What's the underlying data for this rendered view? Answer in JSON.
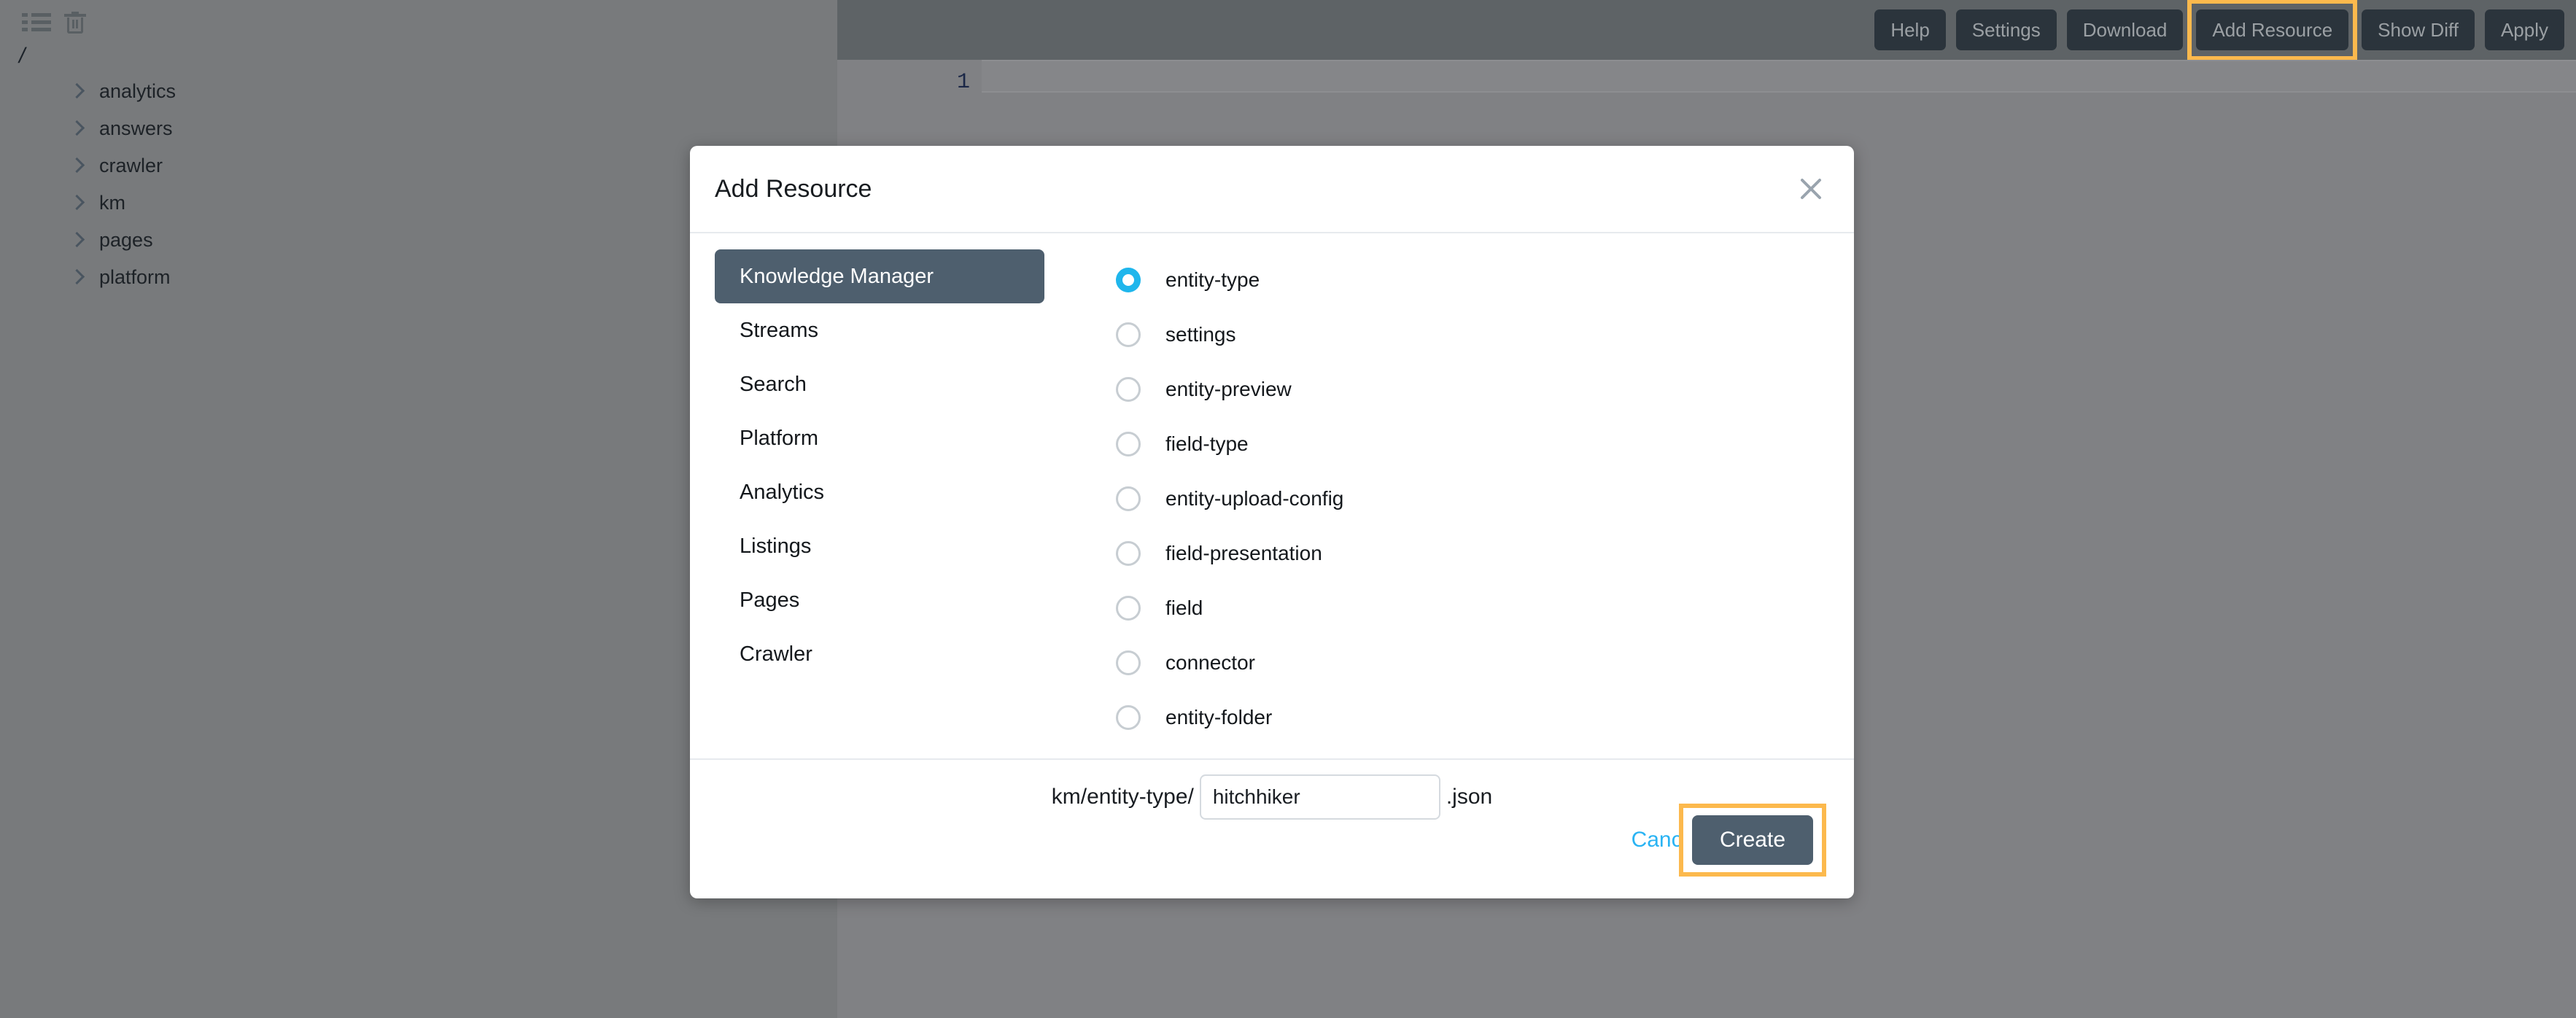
{
  "file_panel": {
    "toolbar_icons": [
      "list-icon",
      "trash-icon"
    ],
    "root_label": "/",
    "tree_items": [
      {
        "label": "analytics"
      },
      {
        "label": "answers"
      },
      {
        "label": "crawler"
      },
      {
        "label": "km"
      },
      {
        "label": "pages"
      },
      {
        "label": "platform"
      }
    ]
  },
  "editor": {
    "toolbar_buttons": [
      {
        "label": "Help",
        "highlighted": false
      },
      {
        "label": "Settings",
        "highlighted": false
      },
      {
        "label": "Download",
        "highlighted": false
      },
      {
        "label": "Add Resource",
        "highlighted": true
      },
      {
        "label": "Show Diff",
        "highlighted": false
      },
      {
        "label": "Apply",
        "highlighted": false
      }
    ],
    "line_number": "1",
    "content": ""
  },
  "modal": {
    "title": "Add Resource",
    "close_icon": "close-icon",
    "categories": [
      {
        "label": "Knowledge Manager",
        "active": true
      },
      {
        "label": "Streams",
        "active": false
      },
      {
        "label": "Search",
        "active": false
      },
      {
        "label": "Platform",
        "active": false
      },
      {
        "label": "Analytics",
        "active": false
      },
      {
        "label": "Listings",
        "active": false
      },
      {
        "label": "Pages",
        "active": false
      },
      {
        "label": "Crawler",
        "active": false
      }
    ],
    "resource_types": [
      {
        "label": "entity-type",
        "selected": true
      },
      {
        "label": "settings",
        "selected": false
      },
      {
        "label": "entity-preview",
        "selected": false
      },
      {
        "label": "field-type",
        "selected": false
      },
      {
        "label": "entity-upload-config",
        "selected": false
      },
      {
        "label": "field-presentation",
        "selected": false
      },
      {
        "label": "field",
        "selected": false
      },
      {
        "label": "connector",
        "selected": false
      },
      {
        "label": "entity-folder",
        "selected": false
      },
      {
        "label": "",
        "selected": false
      }
    ],
    "filename": {
      "prefix": "km/entity-type/",
      "value": "hitchhiker",
      "placeholder": "",
      "suffix": ".json"
    },
    "cancel_label": "Cancel",
    "create_label": "Create"
  },
  "colors": {
    "toolbar_bg": "#5e6366",
    "panel_bg": "#787a7c",
    "editor_bg": "#808184",
    "accent_highlight": "#fcb94d",
    "radio_selected": "#1fb6ec",
    "category_active": "#4e5f6e",
    "link": "#29b3f3"
  }
}
